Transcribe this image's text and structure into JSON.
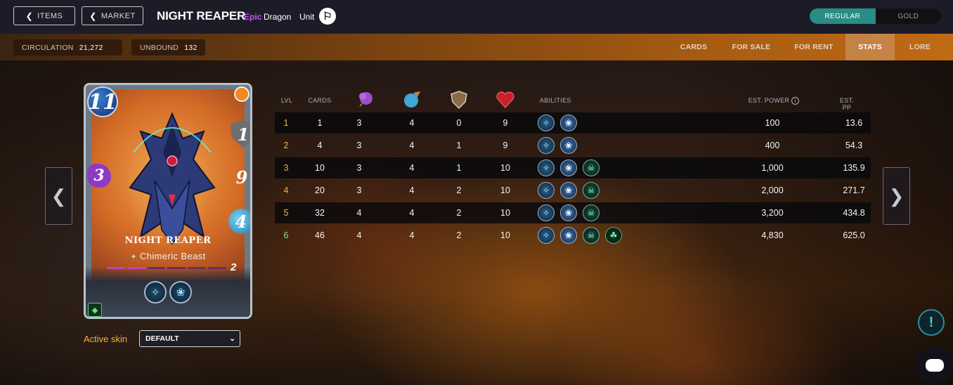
{
  "header": {
    "items_label": "ITEMS",
    "market_label": "MARKET",
    "title": "NIGHT REAPER",
    "rarity": "Epic",
    "element": "Dragon",
    "type": "Unit",
    "toggle": [
      "REGULAR",
      "GOLD"
    ]
  },
  "subbar": {
    "circulation_label": "CIRCULATION",
    "circulation_value": "21,272",
    "unbound_label": "UNBOUND",
    "unbound_value": "132",
    "tabs": [
      "CARDS",
      "FOR SALE",
      "FOR RENT",
      "STATS",
      "LORE"
    ],
    "active_tab": "STATS"
  },
  "card": {
    "name": "NIGHT REAPER",
    "subtype": "Chimeric Beast",
    "mana": "11",
    "armor": "1",
    "health": "9",
    "speed": "4",
    "magic": "3",
    "level": "2"
  },
  "skin": {
    "label": "Active skin",
    "value": "DEFAULT"
  },
  "table": {
    "headers": {
      "lvl": "LVL",
      "cards": "CARDS",
      "abilities": "ABILITIES",
      "power": "EST. POWER",
      "pp": "EST. PP"
    },
    "rows": [
      {
        "lvl": "1",
        "cards": "1",
        "magic": "3",
        "speed": "4",
        "armor": "0",
        "health": "9",
        "power": "100",
        "pp": "13.6",
        "abilities": [
          "flying",
          "heal"
        ]
      },
      {
        "lvl": "2",
        "cards": "4",
        "magic": "3",
        "speed": "4",
        "armor": "1",
        "health": "9",
        "power": "400",
        "pp": "54.3",
        "abilities": [
          "flying",
          "heal"
        ]
      },
      {
        "lvl": "3",
        "cards": "10",
        "magic": "3",
        "speed": "4",
        "armor": "1",
        "health": "10",
        "power": "1,000",
        "pp": "135.9",
        "abilities": [
          "flying",
          "heal",
          "poison"
        ]
      },
      {
        "lvl": "4",
        "cards": "20",
        "magic": "3",
        "speed": "4",
        "armor": "2",
        "health": "10",
        "power": "2,000",
        "pp": "271.7",
        "abilities": [
          "flying",
          "heal",
          "poison"
        ]
      },
      {
        "lvl": "5",
        "cards": "32",
        "magic": "4",
        "speed": "4",
        "armor": "2",
        "health": "10",
        "power": "3,200",
        "pp": "434.8",
        "abilities": [
          "flying",
          "heal",
          "poison"
        ]
      },
      {
        "lvl": "6",
        "cards": "46",
        "magic": "4",
        "speed": "4",
        "armor": "2",
        "health": "10",
        "power": "4,830",
        "pp": "625.0",
        "abilities": [
          "flying",
          "heal",
          "poison",
          "scavenger"
        ]
      }
    ]
  },
  "colors": {
    "epic": "#c455f3",
    "lvl_low": "#f3b13e",
    "lvl_max": "#7ee87e",
    "accent_teal": "#2a8c86"
  }
}
